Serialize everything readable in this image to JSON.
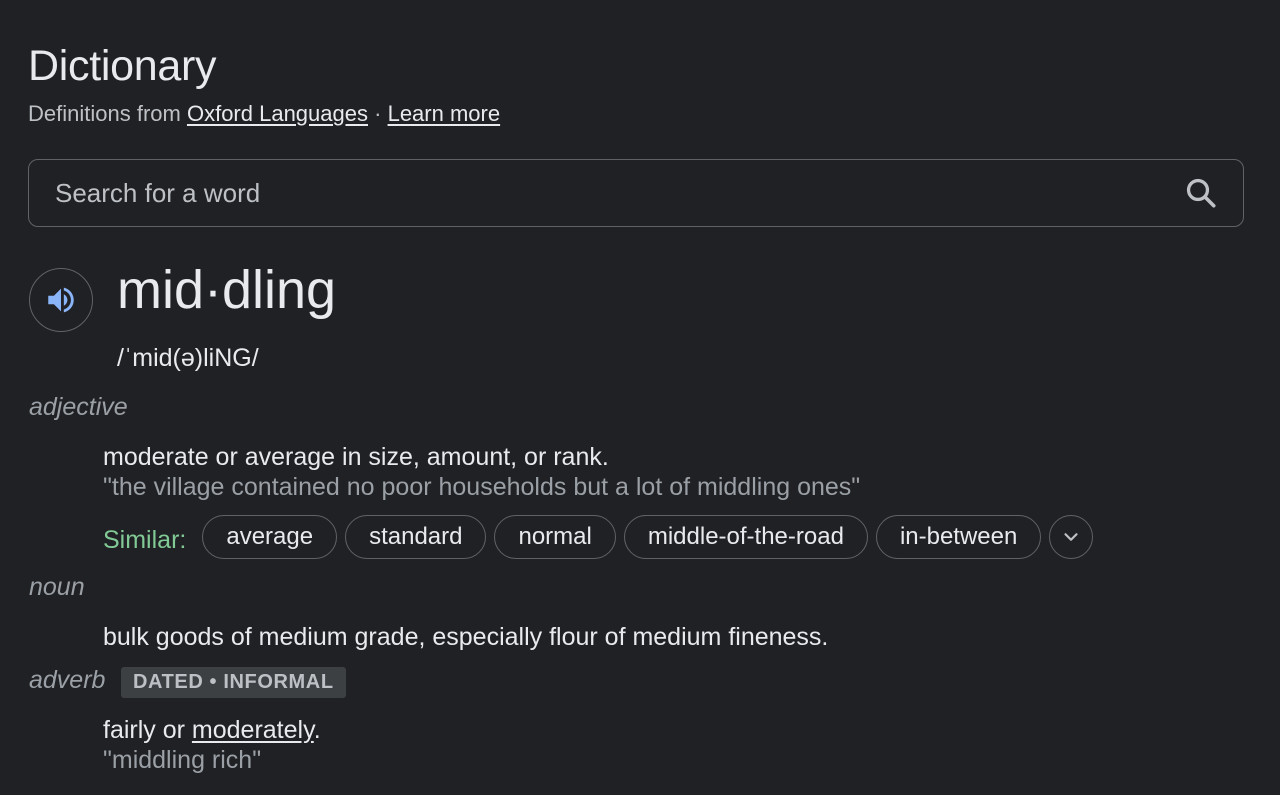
{
  "header": {
    "title": "Dictionary",
    "source_prefix": "Definitions from",
    "source_link": "Oxford Languages",
    "separator": "·",
    "learn_more": "Learn more"
  },
  "search": {
    "placeholder": "Search for a word",
    "value": ""
  },
  "entry": {
    "headword": "mid·dling",
    "phonetic": "/ˈmid(ə)liNG/",
    "senses": [
      {
        "pos": "adjective",
        "definition": "moderate or average in size, amount, or rank.",
        "example": "\"the village contained no poor households but a lot of middling ones\"",
        "similar_label": "Similar:",
        "similar": [
          "average",
          "standard",
          "normal",
          "middle-of-the-road",
          "in-between"
        ]
      },
      {
        "pos": "noun",
        "definition": "bulk goods of medium grade, especially flour of medium fineness."
      },
      {
        "pos": "adverb",
        "label": "DATED • INFORMAL",
        "definition_prefix": "fairly or ",
        "definition_link": "moderately",
        "definition_suffix": ".",
        "example": "\"middling rich\""
      }
    ]
  },
  "colors": {
    "background": "#202124",
    "similar_label": "#81c995",
    "speaker_icon": "#8ab4f8"
  },
  "icons": {
    "search": "search-icon",
    "speaker": "speaker-icon",
    "expand": "chevron-down-icon"
  }
}
